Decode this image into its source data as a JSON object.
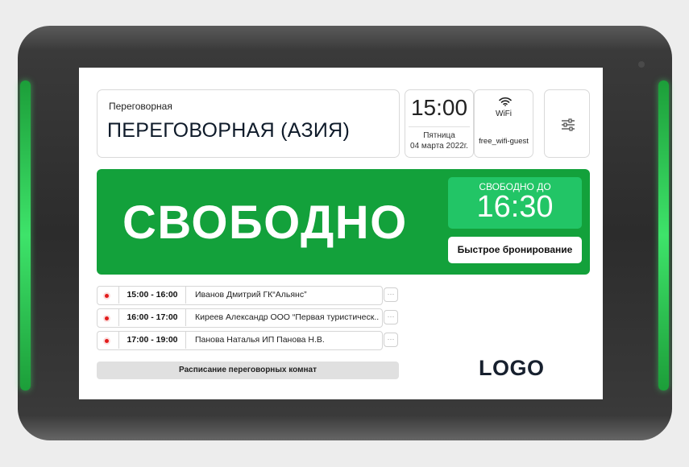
{
  "room": {
    "label": "Переговорная",
    "name": "ПЕРЕГОВОРНАЯ (АЗИЯ)"
  },
  "clock": {
    "time": "15:00",
    "day": "Пятница",
    "date": "04 марта 2022г."
  },
  "wifi": {
    "label": "WiFi",
    "ssid": "free_wifi-guest",
    "icon": "wifi-icon"
  },
  "settings": {
    "icon": "sliders-icon"
  },
  "status": {
    "text": "СВОБОДНО",
    "free_until_label": "СВОБОДНО ДО",
    "free_until_time": "16:30",
    "quick_book_label": "Быстрое бронирование",
    "color": "#13a13b",
    "accent": "#22c566"
  },
  "schedule": {
    "items": [
      {
        "time": "15:00 - 16:00",
        "name": "Иванов Дмитрий ГК“Альянс”"
      },
      {
        "time": "16:00 - 17:00",
        "name": "Киреев Александр ООО “Первая туристическ..."
      },
      {
        "time": "17:00 - 19:00",
        "name": "Панова Наталья ИП Панова Н.В."
      }
    ],
    "comment_icon": "comment-icon",
    "link_label": "Расписание переговорных комнат"
  },
  "logo": "LOGO"
}
